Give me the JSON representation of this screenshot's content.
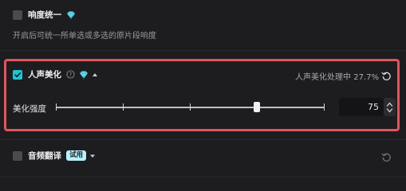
{
  "sections": {
    "loudness": {
      "title": "响度统一",
      "checked": false,
      "description": "开启后可统一所单选或多选的原片段响度",
      "icon": "diamond-icon"
    },
    "voice_beautify": {
      "title": "人声美化",
      "checked": true,
      "status_text": "人声美化处理中 27.7%",
      "icons": [
        "diamond-icon",
        "help-icon",
        "caret-up-icon",
        "reset-icon"
      ],
      "strength_label": "美化强度",
      "strength_value": "75",
      "slider_value": 75
    },
    "audio_translate": {
      "title": "音频翻译",
      "checked": false,
      "badge": "试用",
      "icons": [
        "caret-down-icon",
        "reset-icon"
      ]
    }
  },
  "colors": {
    "accent": "#1fc3d6",
    "highlight_frame": "#e0565b",
    "background": "#1d1d20",
    "badge_bg": "#b8f1ff"
  }
}
